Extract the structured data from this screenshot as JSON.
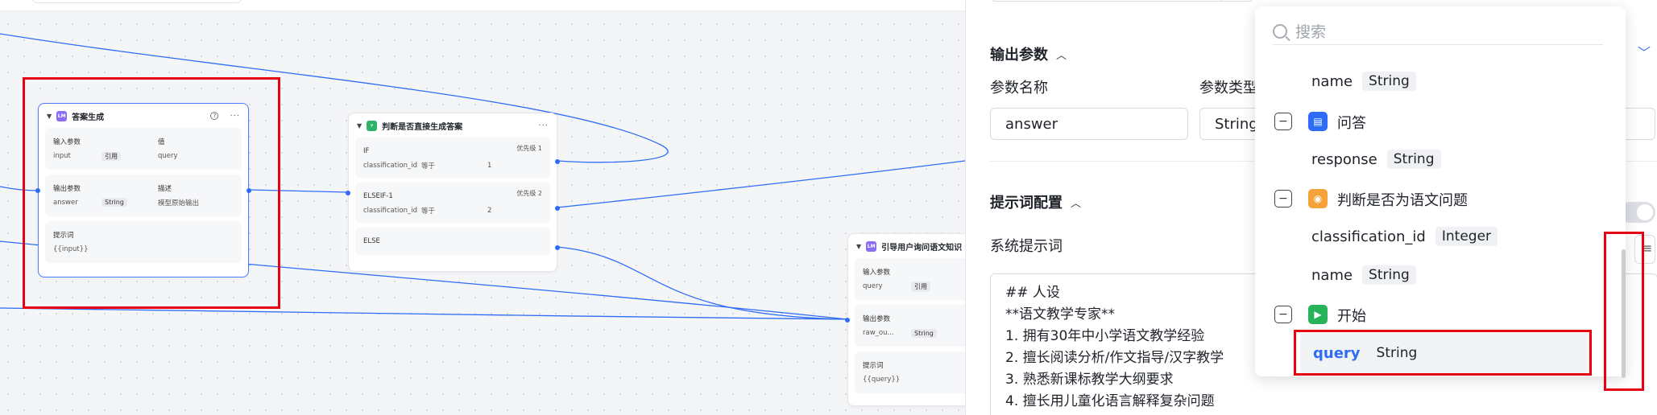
{
  "canvas": {
    "nodes": {
      "answer_gen": {
        "title": "答案生成",
        "input_label": "输入参数",
        "value_label": "值",
        "input_name": "input",
        "input_type": "引用",
        "input_value": "query",
        "output_label": "输出参数",
        "desc_label": "描述",
        "output_name": "answer",
        "output_type": "String",
        "output_desc": "模型原始输出",
        "prompt_label": "提示词",
        "prompt_value": "{{input}}"
      },
      "judge": {
        "title": "判断是否直接生成答案",
        "if_label": "IF",
        "if_prio": "优先级 1",
        "if_var": "classification_id",
        "if_op": "等于",
        "if_val": "1",
        "elseif_label": "ELSEIF-1",
        "elseif_prio": "优先级 2",
        "elseif_var": "classification_id",
        "elseif_op": "等于",
        "elseif_val": "2",
        "else_label": "ELSE"
      },
      "guide": {
        "title": "引导用户询问语文知识",
        "input_label": "输入参数",
        "input_name": "query",
        "input_type": "引用",
        "output_label": "输出参数",
        "output_name": "raw_ou...",
        "output_type": "String",
        "prompt_label": "提示词",
        "prompt_value": "{{query}}"
      }
    },
    "colors": {
      "edge": "#2d6cf6",
      "highlight": "#e60012"
    }
  },
  "panel": {
    "output_title": "输出参数",
    "param_name_label": "参数名称",
    "param_type_label": "参数类型",
    "param_name_value": "answer",
    "param_type_value": "String",
    "prompt_config_title": "提示词配置",
    "system_prompt_label": "系统提示词",
    "system_prompt_lines": [
      "## 人设",
      "**语文教学专家**",
      "1. 拥有30年中小学语文教学经验",
      "2. 擅长阅读分析/作文指导/汉字教学",
      "3. 熟悉新课标教学大纲要求",
      "4. 擅长用儿童化语言解释复杂问题"
    ]
  },
  "dropdown": {
    "search_placeholder": "搜索",
    "items": [
      {
        "name": "name",
        "type": "String"
      },
      {
        "group": "问答",
        "icon": "qa-icon"
      },
      {
        "name": "response",
        "type": "String"
      },
      {
        "group": "判断是否为语文问题",
        "icon": "judge-icon"
      },
      {
        "name": "classification_id",
        "type": "Integer"
      },
      {
        "name": "name",
        "type": "String"
      },
      {
        "group": "开始",
        "icon": "start-icon"
      },
      {
        "name": "query",
        "type": "String",
        "selected": true
      }
    ]
  }
}
